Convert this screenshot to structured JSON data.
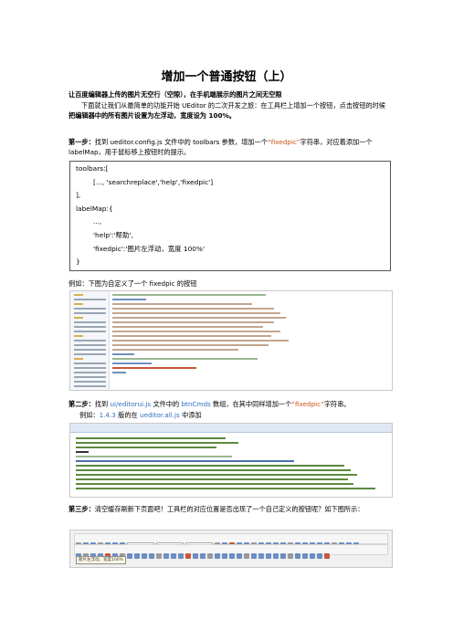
{
  "title": "增加一个普通按钮（上）",
  "subtitle": "让百度编辑器上传的图片无空行（空隙），在手机端展示的图片之间无空隙",
  "intro_prefix": "下面就让我们从最简单的功能开始 UEditor 的二次开发之旅：在工具栏上增加一个按钮，点击按钮的时候",
  "intro_bold": "把编辑器中的所有图片设置为左浮动，宽度设为 100%。",
  "step1": {
    "label": "第一步：",
    "text_a": "找到 ",
    "file": "ueditor.config.js",
    "text_b": " 文件中的 toolbars 参数，增加一个",
    "quote": "“fixedpic”",
    "text_c": "字符串，对应着添加一个 labelMap，用于鼠标移上按钮时的提示。"
  },
  "code": {
    "l1": "toolbars:[",
    "l2": "[..., 'searchreplace','help','fixedpic']",
    "l3": "],",
    "l4": "labelMap:{",
    "l5": "...,",
    "l6": "'help':'帮助',",
    "l7": "'fixedpic':'图片左浮动，宽度 100%'",
    "l8": "}"
  },
  "example1": "例如：下图为自定义了一个 fixedpic 的按钮",
  "step2": {
    "label": "第二步：",
    "text_a": "找到 ",
    "file": "ui/editorui.js",
    "text_b": " 文件中的 ",
    "var": "btnCmds",
    "text_c": " 数组，在其中同样增加一个",
    "quote": "“fixedpic”",
    "text_d": "字符串。"
  },
  "example2": {
    "prefix": "例如：",
    "version": "1.4.3",
    "mid": " 版的在 ",
    "file": "ueditor.all.js",
    "suffix": " 中添加"
  },
  "step3": {
    "label": "第三步：",
    "text": "清空缓存刷新下页面吧！工具栏的对应位置是否出现了一个自己定义的按钮呢？如下图所示："
  },
  "tooltip": "图片左浮动，宽度100%",
  "colors": {
    "blue": "#2c6fbf",
    "red": "#d05016"
  }
}
